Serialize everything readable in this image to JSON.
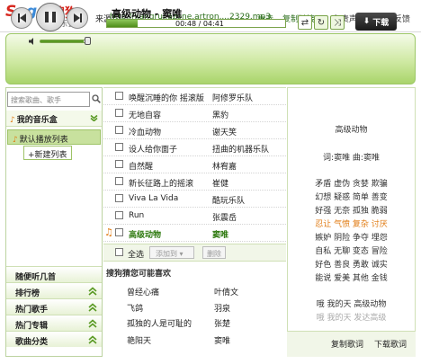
{
  "header": {
    "logo_word": "Sogou",
    "logo_cn_top": "搜狗",
    "logo_cn_bottom": "音乐盒",
    "source_label": "来源：",
    "source_url": "http://jiangrui.azone.artron....2329.mp3",
    "reselect": "重选",
    "copy_link": "复制链接",
    "disclaimer": "免责声明",
    "feedback": "问题反馈"
  },
  "player": {
    "title": "高级动物 - 窦唯",
    "time": "00:48 / 04:41",
    "progress_fraction": 0.17,
    "volume_fraction": 0.92,
    "download_label": "下载",
    "download_arrow": "⬇"
  },
  "sidebar": {
    "search_placeholder": "搜索歌曲、歌手",
    "my_box": "我的音乐盒",
    "default_list": "默认播放列表",
    "new_list": "+新建列表",
    "nav": [
      "随便听几首",
      "排行榜",
      "热门歌手",
      "热门专辑",
      "歌曲分类"
    ]
  },
  "songs": [
    {
      "name": "唤醒沉睡的你 摇滚版",
      "artist": "阿修罗乐队",
      "playing": false
    },
    {
      "name": "无地自容",
      "artist": "黑豹",
      "playing": false
    },
    {
      "name": "冷血动物",
      "artist": "谢天笑",
      "playing": false
    },
    {
      "name": "设人给你面子",
      "artist": "扭曲的机器乐队",
      "playing": false
    },
    {
      "name": "自然醒",
      "artist": "林宥嘉",
      "playing": false
    },
    {
      "name": "新长征路上的摇滚",
      "artist": "崔健",
      "playing": false
    },
    {
      "name": "Viva La Vida",
      "artist": "酷玩乐队",
      "playing": false
    },
    {
      "name": "Run",
      "artist": "张震岳",
      "playing": false
    },
    {
      "name": "高级动物",
      "artist": "窦唯",
      "playing": true
    }
  ],
  "list_footer": {
    "select_all": "全选",
    "add_to": "添加到 ▾",
    "delete": "删除"
  },
  "recommend": {
    "title": "搜狗猜您可能喜欢",
    "items": [
      {
        "name": "曾经心痛",
        "artist": "叶倩文"
      },
      {
        "name": "飞鸽",
        "artist": "羽泉"
      },
      {
        "name": "孤独的人是可耻的",
        "artist": "张楚"
      },
      {
        "name": "艳阳天",
        "artist": "窦唯"
      }
    ]
  },
  "lyrics": {
    "title": "高级动物",
    "credits": "词:窦唯 曲:窦唯",
    "lines": [
      {
        "text": "矛盾 虚伪 贪婪 欺骗",
        "style": "normal"
      },
      {
        "text": "幻想 疑惑 简单 善变",
        "style": "normal"
      },
      {
        "text": "好强 无奈 孤独 脆弱",
        "style": "normal"
      },
      {
        "text": "忍让 气愤 复杂 讨厌",
        "style": "highlight"
      },
      {
        "text": "嫉妒 阴险 争夺 埋怨",
        "style": "normal"
      },
      {
        "text": "自私 无聊 变态 冒险",
        "style": "normal"
      },
      {
        "text": "好色 善良 勇敢 诚实",
        "style": "normal"
      },
      {
        "text": "能说 爱美 其他 金钱",
        "style": "normal"
      },
      {
        "text": "哦 我的天 高级动物",
        "style": "normal"
      },
      {
        "text": "哦 我的天 发达高级",
        "style": "faint"
      }
    ],
    "copy": "复制歌词",
    "download": "下载歌词"
  },
  "colors": {
    "accent_green": "#5a9a24",
    "playing_green": "#2f7a10",
    "highlight_orange": "#e07a10"
  }
}
